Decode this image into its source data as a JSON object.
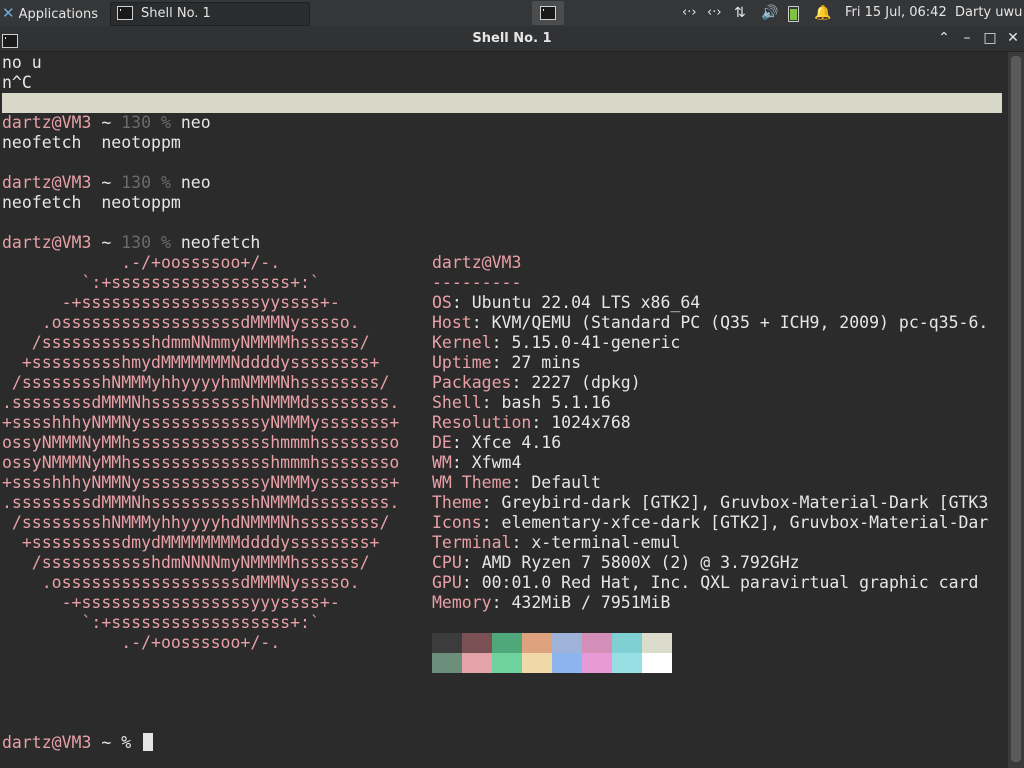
{
  "topbar": {
    "apps_label": "Applications",
    "task_label": "Shell No. 1",
    "net1_glyph": "‹·›",
    "net2_glyph": "‹·›",
    "updown_glyph": "⇅",
    "volume_glyph": "🔊",
    "bell_glyph": "🔔",
    "clock": "Fri 15 Jul, 06:42",
    "user": "Darty uwu"
  },
  "window": {
    "title": "Shell No. 1",
    "shade_glyph": "⌃",
    "min_glyph": "–",
    "max_glyph": "□",
    "close_glyph": "✕"
  },
  "terminal": {
    "line_noU": "no u",
    "line_ctrlC": "n^C",
    "prompt1": {
      "user": "dartz@VM3",
      "path": " ~ ",
      "code": "130",
      "sym": " % ",
      "cmd": "neo"
    },
    "completion1": "neofetch  neotoppm",
    "prompt2": {
      "user": "dartz@VM3",
      "path": " ~ ",
      "code": "130",
      "sym": " % ",
      "cmd": "neo"
    },
    "completion2": "neofetch  neotoppm",
    "prompt3": {
      "user": "dartz@VM3",
      "path": " ~ ",
      "code": "130",
      "sym": " % ",
      "cmd": "neofetch"
    },
    "ascii_art": [
      "            .-/+oossssoo+/-.",
      "        `:+ssssssssssssssssss+:`",
      "      -+ssssssssssssssssssyyssss+-",
      "    .ossssssssssssssssssdMMMNysssso.",
      "   /ssssssssssshdmmNNmmyNMMMMhssssss/",
      "  +ssssssssshmydMMMMMMMNddddyssssssss+",
      " /sssssssshNMMMyhhyyyyhmNMMMNhssssssss/",
      ".ssssssssdMMMNhsssssssssshNMMMdssssssss.",
      "+sssshhhyNMMNyssssssssssssyNMMMysssssss+",
      "ossyNMMMNyMMhsssssssssssssshmmmhssssssso",
      "ossyNMMMNyMMhsssssssssssssshmmmhssssssso",
      "+sssshhhyNMMNyssssssssssssyNMMMysssssss+",
      ".ssssssssdMMMNhsssssssssshNMMMdssssssss.",
      " /sssssssshNMMMyhhyyyyhdNMMMNhssssssss/",
      "  +sssssssssdmydMMMMMMMMddddyssssssss+",
      "   /ssssssssssshdmNNNNmyNMMMMhssssss/",
      "    .ossssssssssssssssssdMMMNysssso.",
      "      -+sssssssssssssssssyyyssss+-",
      "        `:+ssssssssssssssssss+:`",
      "            .-/+oossssoo+/-."
    ],
    "header_user": "dartz@VM3",
    "separator": "---------",
    "info": [
      {
        "key": "OS",
        "value": "Ubuntu 22.04 LTS x86_64"
      },
      {
        "key": "Host",
        "value": "KVM/QEMU (Standard PC (Q35 + ICH9, 2009) pc-q35-6."
      },
      {
        "key": "Kernel",
        "value": "5.15.0-41-generic"
      },
      {
        "key": "Uptime",
        "value": "27 mins"
      },
      {
        "key": "Packages",
        "value": "2227 (dpkg)"
      },
      {
        "key": "Shell",
        "value": "bash 5.1.16"
      },
      {
        "key": "Resolution",
        "value": "1024x768"
      },
      {
        "key": "DE",
        "value": "Xfce 4.16"
      },
      {
        "key": "WM",
        "value": "Xfwm4"
      },
      {
        "key": "WM Theme",
        "value": "Default"
      },
      {
        "key": "Theme",
        "value": "Greybird-dark [GTK2], Gruvbox-Material-Dark [GTK3"
      },
      {
        "key": "Icons",
        "value": "elementary-xfce-dark [GTK2], Gruvbox-Material-Dar"
      },
      {
        "key": "Terminal",
        "value": "x-terminal-emul"
      },
      {
        "key": "CPU",
        "value": "AMD Ryzen 7 5800X (2) @ 3.792GHz"
      },
      {
        "key": "GPU",
        "value": "00:01.0 Red Hat, Inc. QXL paravirtual graphic card"
      },
      {
        "key": "Memory",
        "value": "432MiB / 7951MiB"
      }
    ],
    "palette_top": [
      "#3c3c3c",
      "#7a5055",
      "#4fa77a",
      "#dfa27e",
      "#9fb3d8",
      "#d48fb8",
      "#7fcfd3",
      "#dcdccc"
    ],
    "palette_bottom": [
      "#6b8f7a",
      "#e3a3a8",
      "#6fd19b",
      "#f0d8a8",
      "#8cb5ee",
      "#e79ad6",
      "#97dfe3",
      "#ffffff"
    ],
    "final_prompt": {
      "user": "dartz@VM3",
      "path": " ~ ",
      "sym": "% "
    }
  },
  "colors": {
    "accent_pink": "#e8a0a6",
    "background": "#2b2b2b",
    "foreground": "#e6e6e6"
  }
}
